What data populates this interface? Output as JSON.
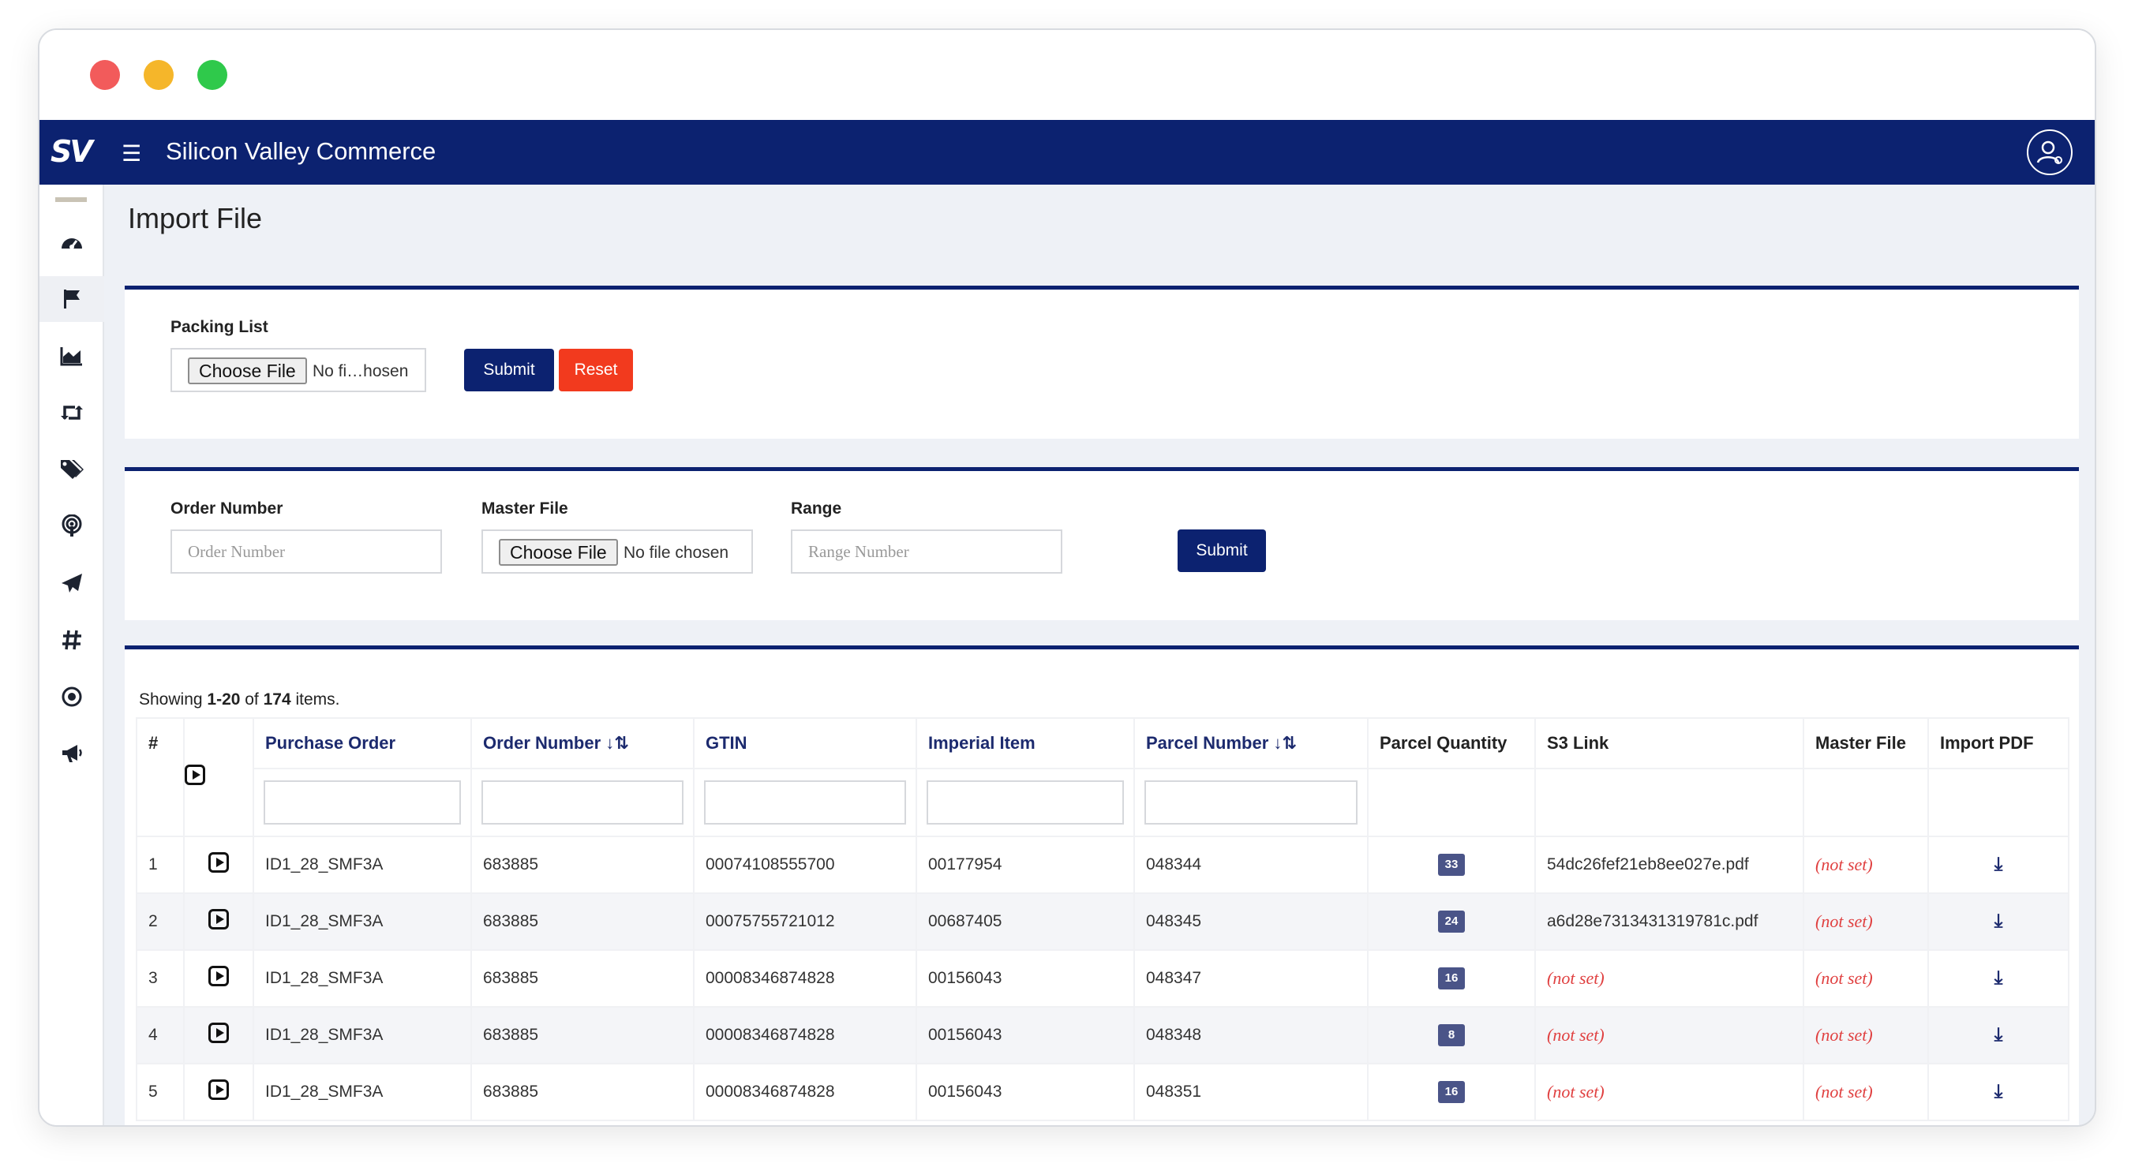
{
  "window": {
    "controls": [
      "close",
      "minimize",
      "maximize"
    ]
  },
  "topbar": {
    "logo": "SV",
    "title": "Silicon Valley Commerce",
    "menu_icon": "hamburger-icon",
    "user_icon": "user-circle-icon"
  },
  "sidebar": {
    "items": [
      {
        "icon": "dashboard-icon"
      },
      {
        "icon": "flag-icon"
      },
      {
        "icon": "area-chart-icon"
      },
      {
        "icon": "retweet-icon"
      },
      {
        "icon": "tags-icon"
      },
      {
        "icon": "podcast-icon"
      },
      {
        "icon": "paper-plane-icon"
      },
      {
        "icon": "hashtag-icon"
      },
      {
        "icon": "dot-circle-icon"
      },
      {
        "icon": "bullhorn-icon"
      }
    ]
  },
  "page": {
    "title": "Import File"
  },
  "packing": {
    "label": "Packing List",
    "file_button": "Choose File",
    "file_status": "No fi…hosen",
    "submit": "Submit",
    "reset": "Reset"
  },
  "order_form": {
    "order_label": "Order Number",
    "order_placeholder": "Order Number",
    "master_label": "Master File",
    "master_button": "Choose File",
    "master_status": "No file chosen",
    "range_label": "Range",
    "range_placeholder": "Range Number",
    "submit": "Submit"
  },
  "table": {
    "summary_prefix": "Showing ",
    "summary_range": "1-20",
    "summary_mid": " of ",
    "summary_total": "174",
    "summary_suffix": " items.",
    "headers": {
      "num": "#",
      "purchase_order": "Purchase Order",
      "order_number": "Order Number",
      "gtin": "GTIN",
      "imperial_item": "Imperial Item",
      "parcel_number": "Parcel Number",
      "parcel_quantity": "Parcel Quantity",
      "s3_link": "S3 Link",
      "master_file": "Master File",
      "import_pdf": "Import PDF"
    },
    "rows": [
      {
        "num": "1",
        "po": "ID1_28_SMF3A",
        "order": "683885",
        "gtin": "00074108555700",
        "item": "00177954",
        "parcel": "048344",
        "qty": "33",
        "s3": "54dc26fef21eb8ee027e.pdf",
        "master": "(not set)"
      },
      {
        "num": "2",
        "po": "ID1_28_SMF3A",
        "order": "683885",
        "gtin": "00075755721012",
        "item": "00687405",
        "parcel": "048345",
        "qty": "24",
        "s3": "a6d28e7313431319781c.pdf",
        "master": "(not set)"
      },
      {
        "num": "3",
        "po": "ID1_28_SMF3A",
        "order": "683885",
        "gtin": "00008346874828",
        "item": "00156043",
        "parcel": "048347",
        "qty": "16",
        "s3": "(not set)",
        "master": "(not set)"
      },
      {
        "num": "4",
        "po": "ID1_28_SMF3A",
        "order": "683885",
        "gtin": "00008346874828",
        "item": "00156043",
        "parcel": "048348",
        "qty": "8",
        "s3": "(not set)",
        "master": "(not set)"
      },
      {
        "num": "5",
        "po": "ID1_28_SMF3A",
        "order": "683885",
        "gtin": "00008346874828",
        "item": "00156043",
        "parcel": "048351",
        "qty": "16",
        "s3": "(not set)",
        "master": "(not set)"
      }
    ]
  },
  "colors": {
    "brand": "#0c2270",
    "danger": "#f23a1e",
    "badge": "#4a5488",
    "notset": "#e04040"
  }
}
